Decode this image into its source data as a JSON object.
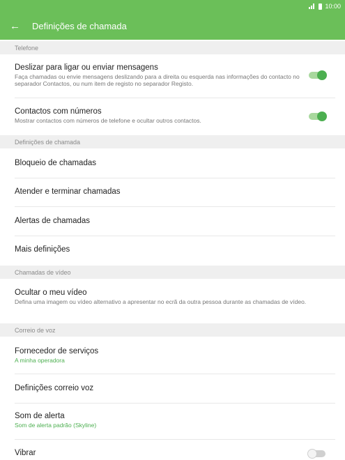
{
  "status_bar": {
    "time": "10:00"
  },
  "app_bar": {
    "title": "Definições de chamada"
  },
  "sections": {
    "telefone": "Telefone",
    "definicoes": "Definições de chamada",
    "video": "Chamadas de vídeo",
    "correio": "Correio de voz"
  },
  "items": {
    "swipe": {
      "title": "Deslizar para ligar ou enviar mensagens",
      "desc": "Faça chamadas ou envie mensagens deslizando para a direita ou esquerda nas informações do contacto no separador Contactos, ou num item de registo no separador Registo.",
      "toggle": "on"
    },
    "contacts": {
      "title": "Contactos com números",
      "desc": "Mostrar contactos com números de telefone e ocultar outros contactos.",
      "toggle": "on"
    },
    "block": {
      "title": "Bloqueio de chamadas"
    },
    "answer": {
      "title": "Atender e terminar chamadas"
    },
    "alerts": {
      "title": "Alertas de chamadas"
    },
    "more": {
      "title": "Mais definições"
    },
    "hide_video": {
      "title": "Ocultar o meu vídeo",
      "desc": "Defina uma imagem ou vídeo alternativo a apresentar no ecrã da outra pessoa durante as chamadas de vídeo."
    },
    "provider": {
      "title": "Fornecedor de serviços",
      "value": "A minha operadora"
    },
    "voicemail": {
      "title": "Definições correio voz"
    },
    "sound": {
      "title": "Som de alerta",
      "value": "Som de alerta padrão (Skyline)"
    },
    "vibrate": {
      "title": "Vibrar",
      "toggle": "off"
    }
  },
  "colors": {
    "accent": "#6bbf59",
    "switch_on": "#4caf50"
  }
}
